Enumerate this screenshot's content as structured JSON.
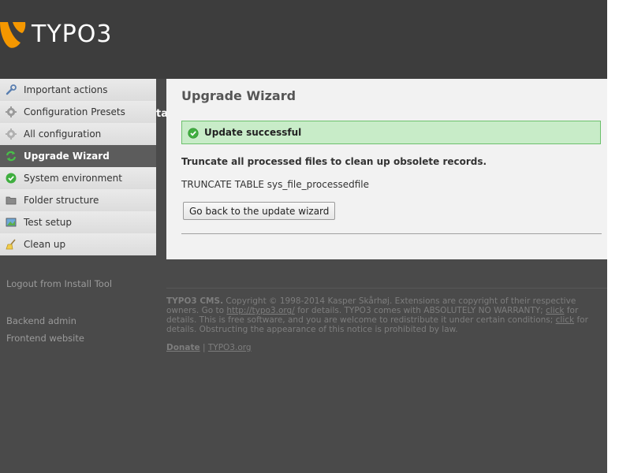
{
  "header": {
    "logo_text": "TYPO3",
    "brand_color": "#f49700"
  },
  "sidebar": {
    "items": [
      {
        "label": "Important actions",
        "icon": "wrench-icon",
        "active": false
      },
      {
        "label": "Configuration Presets",
        "icon": "gear-icon",
        "active": false
      },
      {
        "label": "All configuration",
        "icon": "gear-icon",
        "active": false
      },
      {
        "label": "Upgrade Wizard",
        "icon": "refresh-icon",
        "active": true
      },
      {
        "label": "System environment",
        "icon": "check-circle-icon",
        "active": false
      },
      {
        "label": "Folder structure",
        "icon": "folder-icon",
        "active": false
      },
      {
        "label": "Test setup",
        "icon": "image-icon",
        "active": false
      },
      {
        "label": "Clean up",
        "icon": "broom-icon",
        "active": false
      }
    ],
    "peek_text": "tal",
    "logout_label": "Logout from Install Tool",
    "backend_label": "Backend admin",
    "frontend_label": "Frontend website"
  },
  "main": {
    "title": "Upgrade Wizard",
    "alert": {
      "text": "Update successful",
      "status_color": "#c8ecc8"
    },
    "message": "Truncate all processed files to clean up obsolete records.",
    "query": "TRUNCATE TABLE sys_file_processedfile",
    "back_button_label": "Go back to the update wizard"
  },
  "footer": {
    "brand": "TYPO3 CMS.",
    "copyright": " Copyright © 1998-2014 Kasper Skårhøj. Extensions are copyright of their respective owners. Go to ",
    "link_typo3": "http://typo3.org/",
    "text_2": " for details. TYPO3 comes with ABSOLUTELY NO WARRANTY; ",
    "click_1": "click",
    "text_3": " for details. This is free software, and you are welcome to redistribute it under certain conditions; ",
    "click_2": "click",
    "text_4": " for details. Obstructing the appearance of this notice is prohibited by law.",
    "donate_label": "Donate",
    "separator": "|",
    "typo3org_label": "TYPO3.org"
  }
}
